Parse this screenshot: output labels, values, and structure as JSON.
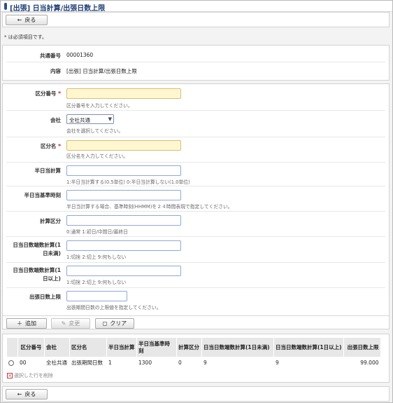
{
  "header": {
    "title": "[出張] 日当計算/出張日数上限"
  },
  "top_back": {
    "label": "戻る"
  },
  "required_note": "* は必須項目です。",
  "info": {
    "common_no_label": "共通番号",
    "common_no_value": "00001360",
    "content_label": "内容",
    "content_value": "[出張] 日当計算/出張日数上限"
  },
  "form": {
    "kubun_no": {
      "label": "区分番号",
      "hint": "区分番号を入力してください。",
      "value": ""
    },
    "company": {
      "label": "会社",
      "selected": "全社共通",
      "hint": "会社を選択してください。"
    },
    "kubun_name": {
      "label": "区分名",
      "hint": "区分名を入力してください。",
      "value": ""
    },
    "half_calc": {
      "label": "半日当計算",
      "hint": "1:半日当計算する(0.5単位) 0:半日当計算しない(1.0単位)",
      "value": ""
    },
    "half_base_time": {
      "label": "半日当基準時刻",
      "hint": "半日当計算する場合、基準時刻(HHMM)を２４時間表現で指定してください。",
      "value": ""
    },
    "calc_kubun": {
      "label": "計算区分",
      "hint": "0:通常 1:初日/中間日/最終日",
      "value": ""
    },
    "round_under": {
      "label_line1": "日当日数端数計算(1",
      "label_line2": "日未満)",
      "hint": "1:切捨 2:切上 9:何もしない",
      "value": ""
    },
    "round_over": {
      "label_line1": "日当日数端数計算(1",
      "label_line2": "日以上)",
      "hint": "1:切捨 2:切上 9:何もしない",
      "value": ""
    },
    "trip_limit": {
      "label": "出張日数上限",
      "hint": "出張期間日数の上限値を指定してください。",
      "value": ""
    }
  },
  "actions": {
    "add": "追加",
    "change": "変更",
    "clear": "クリア"
  },
  "table": {
    "headers": [
      "",
      "区分番号",
      "会社",
      "区分名",
      "半日当計算",
      "半日当基準時刻",
      "計算区分",
      "日当日数端数計算(1日未満)",
      "日当日数端数計算(1日以上)",
      "出張日数上限"
    ],
    "rows": [
      [
        "",
        "00",
        "全社共通",
        "出張期間日数",
        "1",
        "1300",
        "0",
        "9",
        "9",
        "99.000"
      ]
    ]
  },
  "delete_selected": "選択した行を削除",
  "bottom_back": {
    "label": "戻る"
  },
  "colors": {
    "title": "#1f3f77",
    "required": "#cc1f1f",
    "required_field": "#fff7cf"
  }
}
